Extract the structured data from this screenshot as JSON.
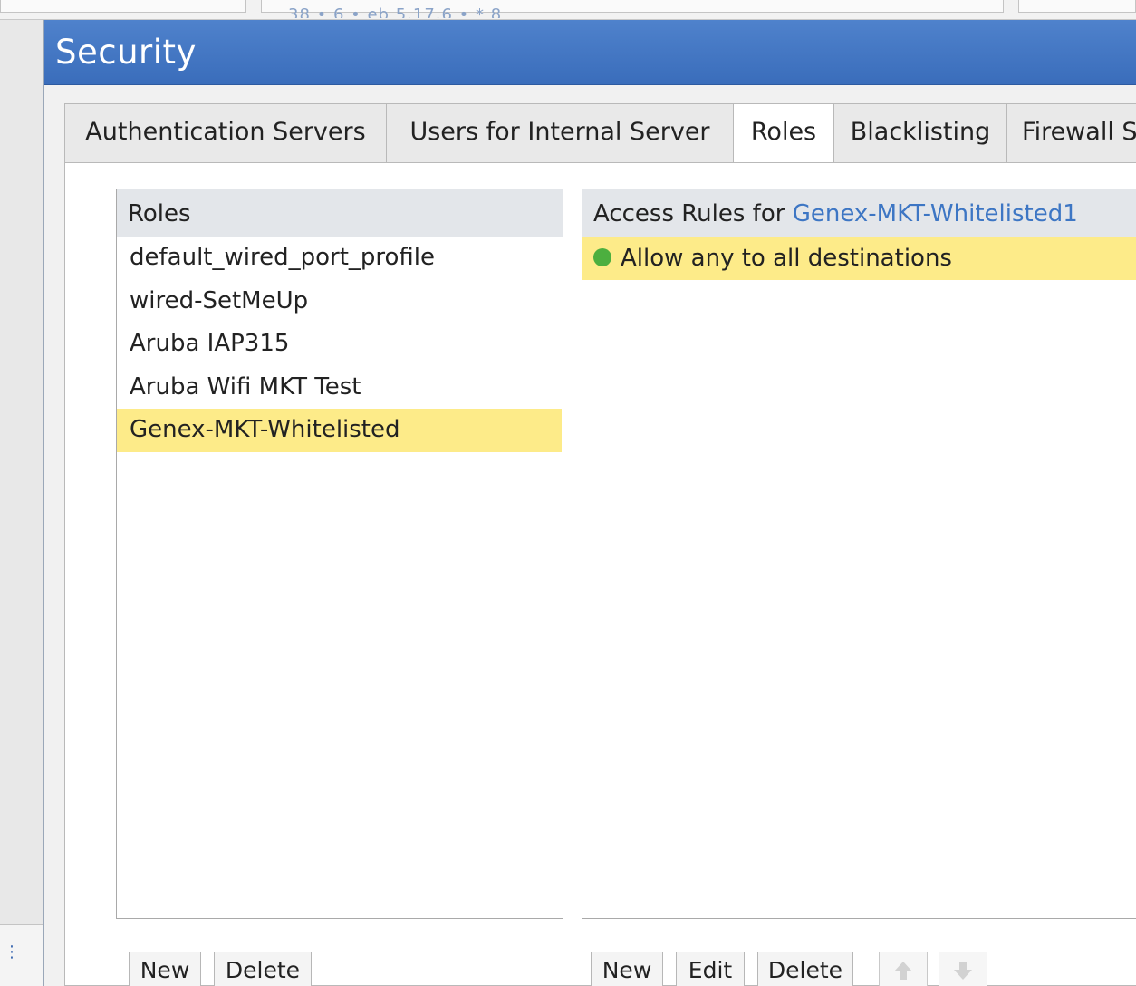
{
  "background": {
    "faded_text": "38 • 6 • eb 5.17.6 •  *       8"
  },
  "dialog": {
    "title": "Security"
  },
  "tabs": [
    {
      "label": "Authentication Servers",
      "active": false
    },
    {
      "label": "Users for Internal Server",
      "active": false
    },
    {
      "label": "Roles",
      "active": true
    },
    {
      "label": "Blacklisting",
      "active": false
    },
    {
      "label": "Firewall S",
      "active": false
    }
  ],
  "roles_panel": {
    "header": "Roles",
    "items": [
      {
        "label": "default_wired_port_profile",
        "selected": false
      },
      {
        "label": "wired-SetMeUp",
        "selected": false
      },
      {
        "label": "Aruba IAP315",
        "selected": false
      },
      {
        "label": "Aruba Wifi MKT Test",
        "selected": false
      },
      {
        "label": "Genex-MKT-Whitelisted",
        "selected": true
      }
    ],
    "buttons": {
      "new": "New",
      "delete": "Delete"
    }
  },
  "rules_panel": {
    "header_prefix": "Access Rules for ",
    "header_role": "Genex-MKT-Whitelisted1",
    "rules": [
      {
        "label": "Allow any to all destinations",
        "status_color": "#4caf3f"
      }
    ],
    "buttons": {
      "new": "New",
      "edit": "Edit",
      "delete": "Delete"
    },
    "icons": {
      "move_up": "arrow-up-icon",
      "move_down": "arrow-down-icon"
    }
  },
  "colors": {
    "titlebar": "#3a6dbb",
    "selection": "#fdeb89",
    "accent_link": "#3d76c4"
  }
}
